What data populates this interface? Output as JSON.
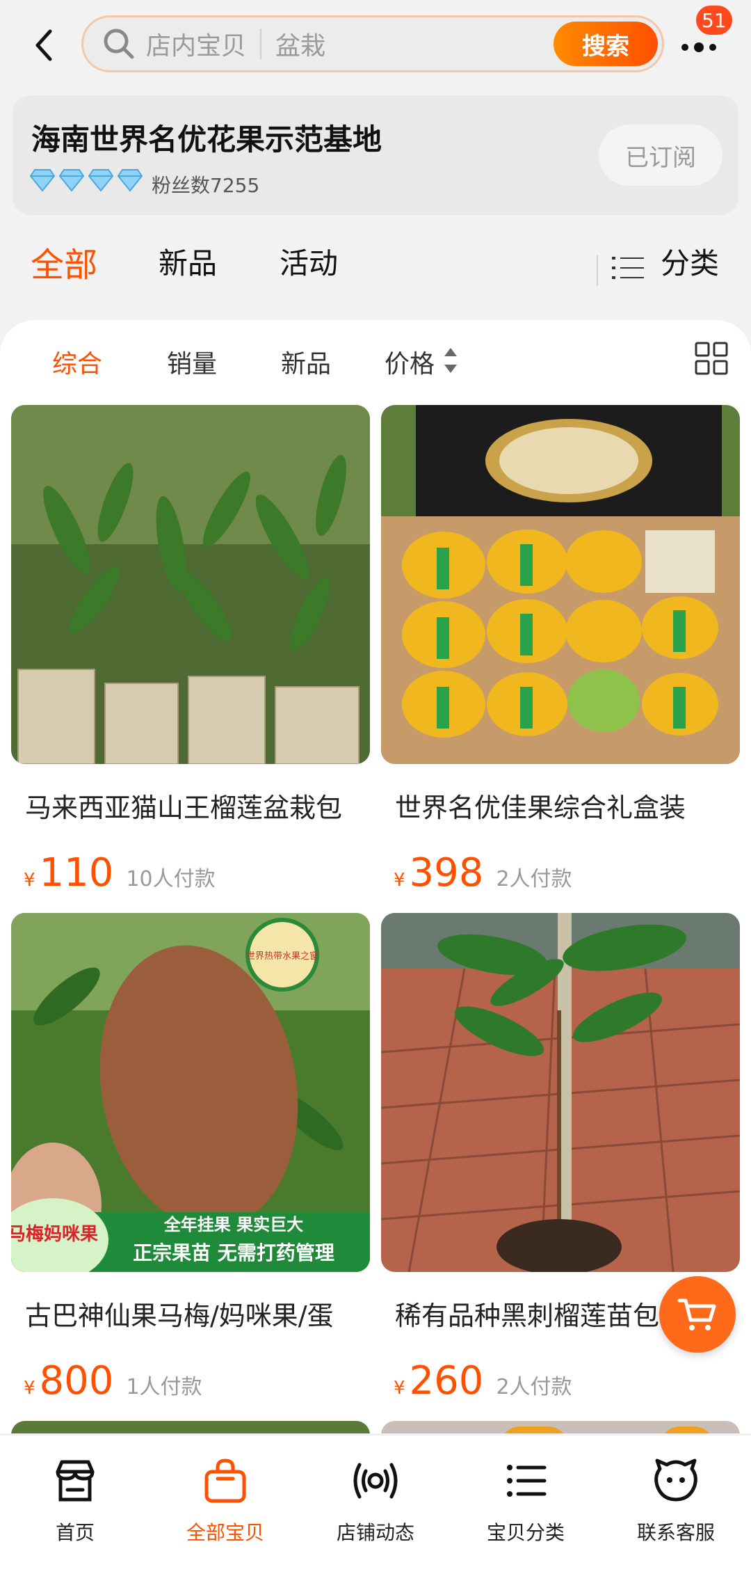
{
  "header": {
    "search_scope": "店内宝贝",
    "search_placeholder": "盆栽",
    "search_button": "搜索",
    "notification_count": "51"
  },
  "shop": {
    "name": "海南世界名优花果示范基地",
    "fans": "粉丝数7255",
    "diamond_count": 4,
    "subscribe_label": "已订阅"
  },
  "tabs": {
    "items": [
      "全部",
      "新品",
      "活动"
    ],
    "active": "全部",
    "category_label": "分类"
  },
  "sort": {
    "items": [
      "综合",
      "销量",
      "新品",
      "价格"
    ],
    "active": "综合"
  },
  "products": [
    {
      "title": "马来西亚猫山王榴莲盆栽包",
      "currency": "¥",
      "price": "110",
      "buyers": "10人付款"
    },
    {
      "title": "世界名优佳果综合礼盒装",
      "currency": "¥",
      "price": "398",
      "buyers": "2人付款"
    },
    {
      "title": "古巴神仙果马梅/妈咪果/蛋",
      "currency": "¥",
      "price": "800",
      "buyers": "1人付款",
      "image_text": {
        "tag": "马梅妈咪果",
        "banner_top": "全年挂果 果实巨大",
        "banner_bottom": "正宗果苗 无需打药管理",
        "logo": "世界热带水果之窗"
      }
    },
    {
      "title": "稀有品种黑刺榴莲苗包",
      "currency": "¥",
      "price": "260",
      "buyers": "2人付款"
    }
  ],
  "bottom_nav": {
    "items": [
      "首页",
      "全部宝贝",
      "店铺动态",
      "宝贝分类",
      "联系客服"
    ],
    "active": "全部宝贝"
  },
  "colors": {
    "accent": "#ff5000",
    "background": "#f2f2f2",
    "diamond": "#8fd3f7"
  },
  "icons": [
    "back-icon",
    "search-icon",
    "more-icon",
    "diamond-icon",
    "list-icon",
    "sort-arrows-icon",
    "grid-icon",
    "cart-icon",
    "store-icon",
    "bag-icon",
    "broadcast-icon",
    "list-icon",
    "chat-bot-icon"
  ]
}
